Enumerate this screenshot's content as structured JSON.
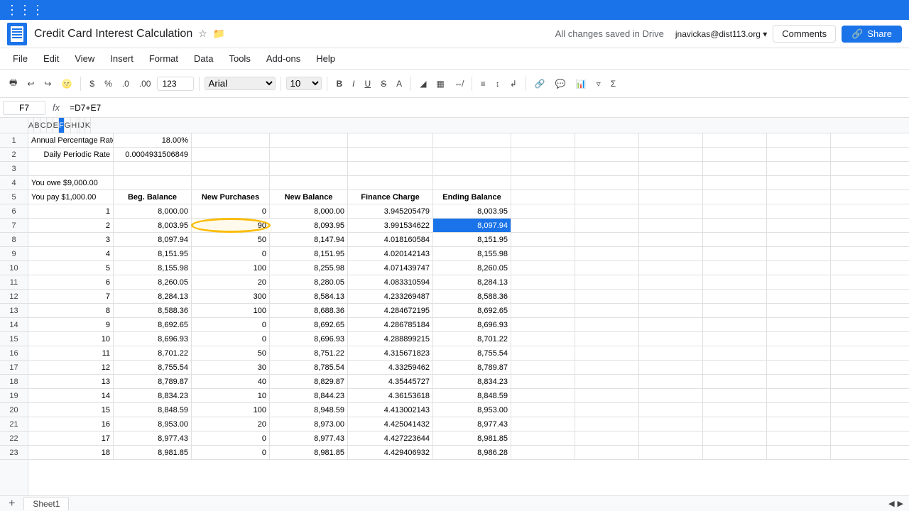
{
  "app": {
    "title": "Credit Card Interest Calculation",
    "drive_status": "All changes saved in Drive",
    "user_email": "jnavickas@dist113.org ▾"
  },
  "menu": {
    "items": [
      "File",
      "Edit",
      "View",
      "Insert",
      "Format",
      "Data",
      "Tools",
      "Add-ons",
      "Help"
    ]
  },
  "toolbar": {
    "font": "Arial",
    "size": "10",
    "currency_label": "$",
    "percent_label": "%",
    "zoom": "123"
  },
  "formula_bar": {
    "cell_ref": "F7",
    "fx": "fx",
    "formula": "=D7+E7"
  },
  "columns": {
    "headers": [
      "A",
      "B",
      "C",
      "D",
      "E",
      "F",
      "G",
      "H",
      "I",
      "J",
      "K"
    ]
  },
  "rows": {
    "nums": [
      1,
      2,
      3,
      4,
      5,
      6,
      7,
      8,
      9,
      10,
      11,
      12,
      13,
      14,
      15,
      16,
      17,
      18,
      19,
      20,
      21,
      22,
      23
    ]
  },
  "cells": {
    "r1": {
      "a": "Annual Percentage Rate",
      "b": "18.00%",
      "c": "",
      "d": "",
      "e": "",
      "f": "",
      "g": ""
    },
    "r2": {
      "a": "Daily Periodic Rate",
      "b": "0.0004931506849",
      "c": "",
      "d": "",
      "e": "",
      "f": "",
      "g": ""
    },
    "r3": {
      "a": "",
      "b": "",
      "c": "",
      "d": "",
      "e": "",
      "f": "",
      "g": ""
    },
    "r4": {
      "a": "You owe $9,000.00",
      "b": "",
      "c": "",
      "d": "",
      "e": "",
      "f": "",
      "g": ""
    },
    "r5_a": "You pay $1,000.00",
    "r5_b": "Beg. Balance",
    "r5_c": "New Purchases",
    "r5_d": "New Balance",
    "r5_e": "Finance Charge",
    "r5_f": "Ending Balance",
    "data": [
      {
        "row": 6,
        "num": 1,
        "beg": "8,000.00",
        "new_purch": "0",
        "new_bal": "8,000.00",
        "fin_charge": "3.945205479",
        "end_bal": "8,003.95"
      },
      {
        "row": 7,
        "num": 2,
        "beg": "8,003.95",
        "new_purch": "90",
        "new_bal": "8,093.95",
        "fin_charge": "3.991534622",
        "end_bal": "8,097.94",
        "selected_f": true
      },
      {
        "row": 8,
        "num": 3,
        "beg": "8,097.94",
        "new_purch": "50",
        "new_bal": "8,147.94",
        "fin_charge": "4.018160584",
        "end_bal": "8,151.95"
      },
      {
        "row": 9,
        "num": 4,
        "beg": "8,151.95",
        "new_purch": "0",
        "new_bal": "8,151.95",
        "fin_charge": "4.020142143",
        "end_bal": "8,155.98"
      },
      {
        "row": 10,
        "num": 5,
        "beg": "8,155.98",
        "new_purch": "100",
        "new_bal": "8,255.98",
        "fin_charge": "4.071439747",
        "end_bal": "8,260.05"
      },
      {
        "row": 11,
        "num": 6,
        "beg": "8,260.05",
        "new_purch": "20",
        "new_bal": "8,280.05",
        "fin_charge": "4.083310594",
        "end_bal": "8,284.13"
      },
      {
        "row": 12,
        "num": 7,
        "beg": "8,284.13",
        "new_purch": "300",
        "new_bal": "8,584.13",
        "fin_charge": "4.233269487",
        "end_bal": "8,588.36"
      },
      {
        "row": 13,
        "num": 8,
        "beg": "8,588.36",
        "new_purch": "100",
        "new_bal": "8,688.36",
        "fin_charge": "4.284672195",
        "end_bal": "8,692.65"
      },
      {
        "row": 14,
        "num": 9,
        "beg": "8,692.65",
        "new_purch": "0",
        "new_bal": "8,692.65",
        "fin_charge": "4.286785184",
        "end_bal": "8,696.93"
      },
      {
        "row": 15,
        "num": 10,
        "beg": "8,696.93",
        "new_purch": "0",
        "new_bal": "8,696.93",
        "fin_charge": "4.288899215",
        "end_bal": "8,701.22"
      },
      {
        "row": 16,
        "num": 11,
        "beg": "8,701.22",
        "new_purch": "50",
        "new_bal": "8,751.22",
        "fin_charge": "4.315671823",
        "end_bal": "8,755.54"
      },
      {
        "row": 17,
        "num": 12,
        "beg": "8,755.54",
        "new_purch": "30",
        "new_bal": "8,785.54",
        "fin_charge": "4.33259462",
        "end_bal": "8,789.87"
      },
      {
        "row": 18,
        "num": 13,
        "beg": "8,789.87",
        "new_purch": "40",
        "new_bal": "8,829.87",
        "fin_charge": "4.35445727",
        "end_bal": "8,834.23"
      },
      {
        "row": 19,
        "num": 14,
        "beg": "8,834.23",
        "new_purch": "10",
        "new_bal": "8,844.23",
        "fin_charge": "4.36153618",
        "end_bal": "8,848.59"
      },
      {
        "row": 20,
        "num": 15,
        "beg": "8,848.59",
        "new_purch": "100",
        "new_bal": "8,948.59",
        "fin_charge": "4.413002143",
        "end_bal": "8,953.00"
      },
      {
        "row": 21,
        "num": 16,
        "beg": "8,953.00",
        "new_purch": "20",
        "new_bal": "8,973.00",
        "fin_charge": "4.425041432",
        "end_bal": "8,977.43"
      },
      {
        "row": 22,
        "num": 17,
        "beg": "8,977.43",
        "new_purch": "0",
        "new_bal": "8,977.43",
        "fin_charge": "4.427223644",
        "end_bal": "8,981.85"
      },
      {
        "row": 23,
        "num": 18,
        "beg": "8,981.85",
        "new_purch": "0",
        "new_bal": "8,981.85",
        "fin_charge": "4.429406932",
        "end_bal": "8,986.28"
      }
    ]
  },
  "buttons": {
    "comments": "Comments",
    "share": "Share"
  },
  "bottom": {
    "sheet_name": "Sheet1",
    "add_sheet": "+"
  }
}
